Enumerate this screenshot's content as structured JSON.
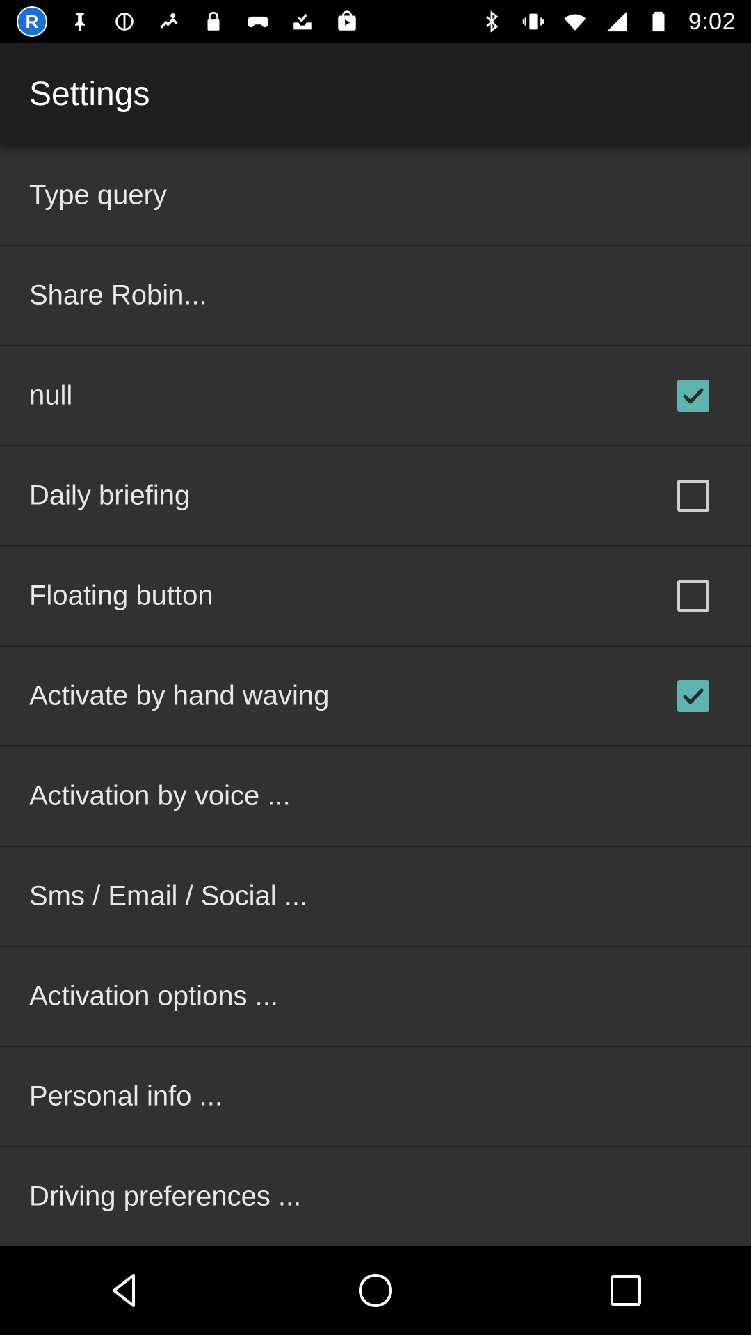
{
  "status_bar": {
    "app_badge_letter": "R",
    "time": "9:02",
    "left_icons": [
      "app-badge-icon",
      "pin-icon",
      "no-location-icon",
      "gps-fake-icon",
      "lock-icon",
      "game-controller-icon",
      "tray-check-icon",
      "play-store-icon"
    ],
    "right_icons": [
      "bluetooth-icon",
      "vibrate-icon",
      "wifi-icon",
      "signal-icon",
      "battery-icon"
    ]
  },
  "app_bar": {
    "title": "Settings"
  },
  "settings": {
    "items": [
      {
        "label": "Type query",
        "checkbox": "none"
      },
      {
        "label": "Share Robin...",
        "checkbox": "none"
      },
      {
        "label": "null",
        "checkbox": "checked"
      },
      {
        "label": "Daily briefing",
        "checkbox": "unchecked"
      },
      {
        "label": "Floating button",
        "checkbox": "unchecked"
      },
      {
        "label": "Activate by hand waving",
        "checkbox": "checked"
      },
      {
        "label": "Activation by voice ...",
        "checkbox": "none"
      },
      {
        "label": "Sms / Email / Social ...",
        "checkbox": "none"
      },
      {
        "label": "Activation options ...",
        "checkbox": "none"
      },
      {
        "label": "Personal info ...",
        "checkbox": "none"
      },
      {
        "label": "Driving preferences ...",
        "checkbox": "none"
      }
    ]
  },
  "nav_bar": {
    "buttons": [
      "back-icon",
      "home-icon",
      "recents-icon"
    ]
  },
  "colors": {
    "checkbox_checked": "#5fb3b0",
    "background": "#313131",
    "app_bar": "#1f1f1f"
  }
}
